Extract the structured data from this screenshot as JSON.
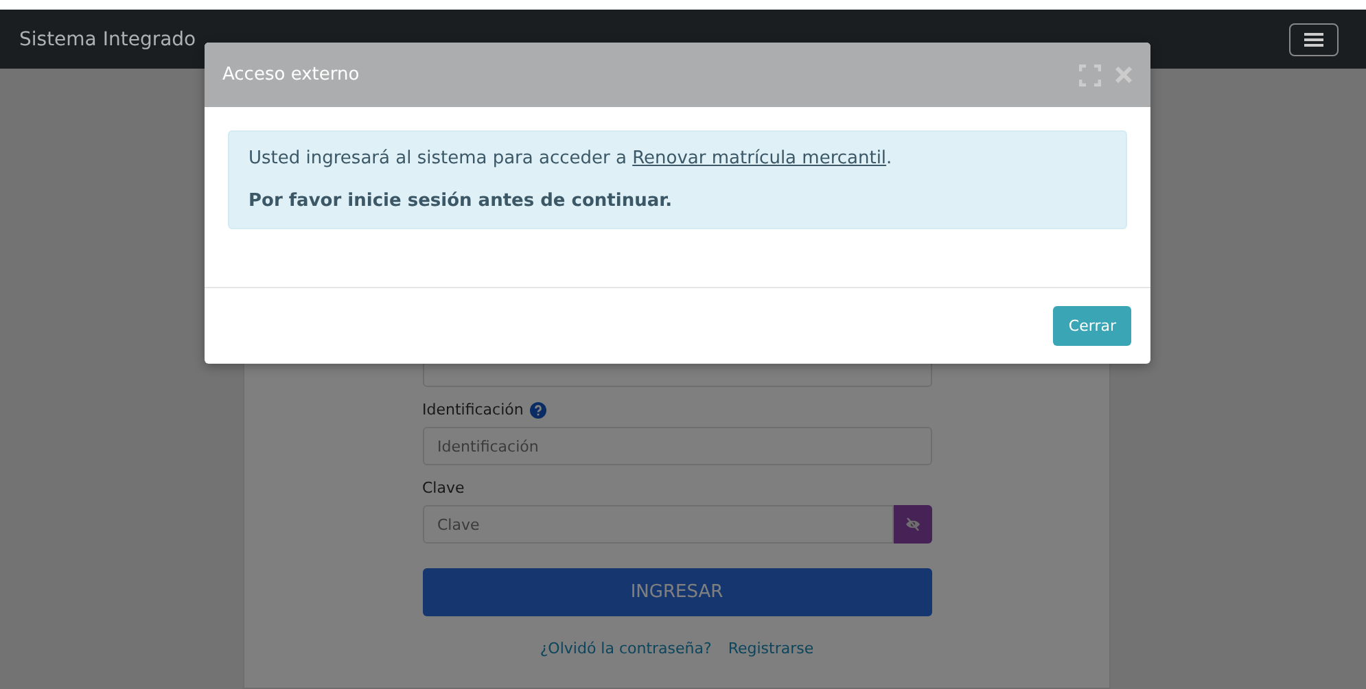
{
  "navbar": {
    "title": "Sistema Integrado"
  },
  "login_form": {
    "fields": [
      {
        "label": "Identificación",
        "placeholder": "Identificación",
        "help": true,
        "password": false
      },
      {
        "label": "Clave",
        "placeholder": "Clave",
        "help": false,
        "password": true
      }
    ],
    "submit": "INGRESAR",
    "links": [
      "¿Olvidó la contraseña?",
      "Registrarse"
    ]
  },
  "modal": {
    "title": "Acceso externo",
    "message": "Usted ingresará al sistema para acceder a ",
    "link": "Renovar matrícula mercantil",
    "message_end": ".",
    "notice": "Por favor inicie sesión antes de continuar.",
    "button": "Cerrar"
  }
}
